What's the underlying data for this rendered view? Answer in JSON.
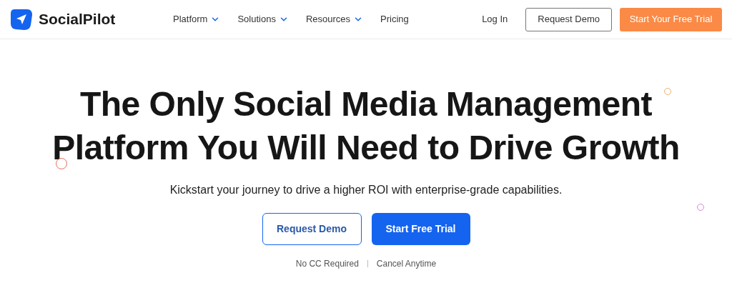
{
  "header": {
    "brand": "SocialPilot",
    "nav": [
      {
        "label": "Platform",
        "dropdown": true
      },
      {
        "label": "Solutions",
        "dropdown": true
      },
      {
        "label": "Resources",
        "dropdown": true
      },
      {
        "label": "Pricing",
        "dropdown": false
      }
    ],
    "login": "Log In",
    "demo_button": "Request Demo",
    "trial_button": "Start Your Free Trial"
  },
  "hero": {
    "headline_lines": [
      "The Only Social Media Management",
      "Platform You Will Need to Drive Growth"
    ],
    "subtitle": "Kickstart your journey to drive a higher ROI with enterprise-grade capabilities.",
    "demo_button": "Request Demo",
    "trial_button": "Start Free Trial",
    "notes": [
      "No CC Required",
      "Cancel Anytime"
    ],
    "rings": [
      {
        "color": "#f0b070"
      },
      {
        "color": "#e8705a"
      },
      {
        "color": "#d888d8"
      }
    ]
  }
}
